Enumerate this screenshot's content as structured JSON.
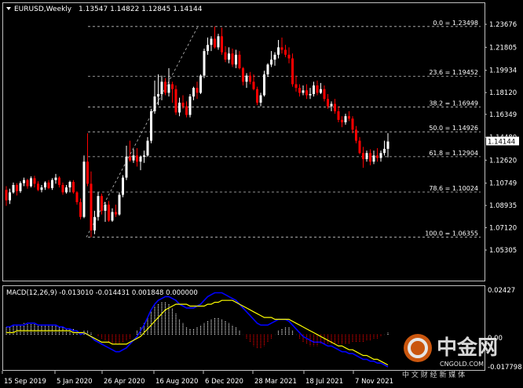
{
  "header": {
    "symbol": "EURUSD,Weekly",
    "ohlc": "1.13547 1.14822 1.12845 1.14144"
  },
  "colors": {
    "background": "#000000",
    "bull": "#ffffff",
    "bear": "#ff0000",
    "grid": "#c0c0c0",
    "macd_main": "#0000ff",
    "macd_signal": "#ffff00",
    "histogram_pos": "#ffffff",
    "histogram_neg": "#ff0000",
    "current_price_bg": "#ffffff"
  },
  "price_axis": {
    "ticks": [
      "1.23676",
      "1.21805",
      "1.19934",
      "1.18120",
      "1.16349",
      "1.14480",
      "1.12620",
      "1.10749",
      "1.08935",
      "1.07120",
      "1.05305"
    ],
    "current_price": "1.14144"
  },
  "fibonacci": [
    {
      "label": "0.0 = 1.23498",
      "value": 1.23498
    },
    {
      "label": "23.6 = 1.19452",
      "value": 1.19452
    },
    {
      "label": "38.2 = 1.16949",
      "value": 1.16949
    },
    {
      "label": "50.0 = 1.14926",
      "value": 1.14926
    },
    {
      "label": "61.8 = 1.12904",
      "value": 1.12904
    },
    {
      "label": "78.6 = 1.10024",
      "value": 1.10024
    },
    {
      "label": "100.0 = 1.06355",
      "value": 1.06355
    }
  ],
  "macd": {
    "label": "MACD(12,26,9) -0.013010 -0.014431 0.001848 0.000000",
    "ticks": [
      "0.02427",
      "0.00",
      "-0.017798"
    ]
  },
  "time_axis": {
    "labels": [
      "15 Sep 2019",
      "5 Jan 2020",
      "26 Apr 2020",
      "16 Aug 2020",
      "6 Dec 2020",
      "28 Mar 2021",
      "18 Jul 2021",
      "7 Nov 2021"
    ]
  },
  "watermark": {
    "brand": "中金网",
    "tagline": "中 文 财 经 新 媒 体",
    "url": "CNGOLD.COM"
  },
  "chart_data": {
    "type": "candlestick",
    "title": "EURUSD,Weekly",
    "ylim": [
      1.0455,
      1.2435
    ],
    "bars": [
      [
        1.102,
        1.105,
        1.089,
        1.0935
      ],
      [
        1.0935,
        1.103,
        1.0905,
        1.1
      ],
      [
        1.1,
        1.108,
        1.099,
        1.106
      ],
      [
        1.106,
        1.1075,
        1.0975,
        1.101
      ],
      [
        1.101,
        1.109,
        1.0995,
        1.1075
      ],
      [
        1.1075,
        1.112,
        1.105,
        1.11
      ],
      [
        1.11,
        1.111,
        1.103,
        1.105
      ],
      [
        1.105,
        1.113,
        1.104,
        1.1115
      ],
      [
        1.1115,
        1.1135,
        1.104,
        1.107
      ],
      [
        1.107,
        1.109,
        1.101,
        1.102
      ],
      [
        1.102,
        1.106,
        1.1,
        1.104
      ],
      [
        1.104,
        1.109,
        1.102,
        1.108
      ],
      [
        1.108,
        1.11,
        1.1025,
        1.1035
      ],
      [
        1.1035,
        1.1115,
        1.102,
        1.11
      ],
      [
        1.11,
        1.115,
        1.107,
        1.112
      ],
      [
        1.112,
        1.113,
        1.104,
        1.106
      ],
      [
        1.106,
        1.108,
        1.098,
        1.1
      ],
      [
        1.1,
        1.106,
        1.099,
        1.104
      ],
      [
        1.104,
        1.1095,
        1.1,
        1.1085
      ],
      [
        1.1085,
        1.11,
        1.099,
        1.1
      ],
      [
        1.1,
        1.101,
        1.09,
        1.092
      ],
      [
        1.092,
        1.095,
        1.078,
        1.08
      ],
      [
        1.08,
        1.13,
        1.079,
        1.125
      ],
      [
        1.125,
        1.148,
        1.105,
        1.107
      ],
      [
        1.107,
        1.117,
        1.0635,
        1.069
      ],
      [
        1.069,
        1.085,
        1.066,
        1.08
      ],
      [
        1.08,
        1.1,
        1.077,
        1.097
      ],
      [
        1.097,
        1.099,
        1.082,
        1.085
      ],
      [
        1.085,
        1.092,
        1.076,
        1.09
      ],
      [
        1.09,
        1.093,
        1.076,
        1.077
      ],
      [
        1.077,
        1.087,
        1.076,
        1.084
      ],
      [
        1.084,
        1.09,
        1.08,
        1.082
      ],
      [
        1.082,
        1.1,
        1.081,
        1.098
      ],
      [
        1.098,
        1.114,
        1.096,
        1.112
      ],
      [
        1.112,
        1.138,
        1.11,
        1.129
      ],
      [
        1.129,
        1.142,
        1.125,
        1.126
      ],
      [
        1.126,
        1.135,
        1.124,
        1.13
      ],
      [
        1.13,
        1.136,
        1.121,
        1.125
      ],
      [
        1.125,
        1.13,
        1.118,
        1.129
      ],
      [
        1.129,
        1.134,
        1.124,
        1.13
      ],
      [
        1.13,
        1.145,
        1.129,
        1.142
      ],
      [
        1.142,
        1.168,
        1.14,
        1.166
      ],
      [
        1.166,
        1.191,
        1.164,
        1.178
      ],
      [
        1.178,
        1.196,
        1.171,
        1.18
      ],
      [
        1.18,
        1.195,
        1.175,
        1.19
      ],
      [
        1.19,
        1.193,
        1.179,
        1.181
      ],
      [
        1.181,
        1.201,
        1.178,
        1.188
      ],
      [
        1.188,
        1.19,
        1.173,
        1.184
      ],
      [
        1.184,
        1.187,
        1.163,
        1.165
      ],
      [
        1.165,
        1.177,
        1.162,
        1.173
      ],
      [
        1.173,
        1.179,
        1.168,
        1.17
      ],
      [
        1.17,
        1.174,
        1.161,
        1.163
      ],
      [
        1.163,
        1.18,
        1.161,
        1.178
      ],
      [
        1.178,
        1.186,
        1.175,
        1.185
      ],
      [
        1.185,
        1.19,
        1.176,
        1.181
      ],
      [
        1.181,
        1.196,
        1.18,
        1.195
      ],
      [
        1.195,
        1.217,
        1.193,
        1.215
      ],
      [
        1.215,
        1.226,
        1.212,
        1.22
      ],
      [
        1.22,
        1.227,
        1.215,
        1.225
      ],
      [
        1.225,
        1.235,
        1.217,
        1.218
      ],
      [
        1.218,
        1.229,
        1.216,
        1.227
      ],
      [
        1.227,
        1.234,
        1.212,
        1.214
      ],
      [
        1.214,
        1.219,
        1.206,
        1.208
      ],
      [
        1.208,
        1.218,
        1.205,
        1.213
      ],
      [
        1.213,
        1.217,
        1.202,
        1.204
      ],
      [
        1.204,
        1.216,
        1.201,
        1.212
      ],
      [
        1.212,
        1.215,
        1.2,
        1.201
      ],
      [
        1.201,
        1.202,
        1.187,
        1.19
      ],
      [
        1.19,
        1.197,
        1.185,
        1.195
      ],
      [
        1.195,
        1.198,
        1.188,
        1.19
      ],
      [
        1.19,
        1.196,
        1.183,
        1.184
      ],
      [
        1.184,
        1.186,
        1.171,
        1.173
      ],
      [
        1.173,
        1.181,
        1.17,
        1.179
      ],
      [
        1.179,
        1.199,
        1.178,
        1.196
      ],
      [
        1.196,
        1.205,
        1.194,
        1.204
      ],
      [
        1.204,
        1.215,
        1.202,
        1.208
      ],
      [
        1.208,
        1.214,
        1.203,
        1.212
      ],
      [
        1.212,
        1.224,
        1.209,
        1.218
      ],
      [
        1.218,
        1.226,
        1.213,
        1.216
      ],
      [
        1.216,
        1.22,
        1.21,
        1.212
      ],
      [
        1.212,
        1.218,
        1.205,
        1.209
      ],
      [
        1.209,
        1.213,
        1.186,
        1.188
      ],
      [
        1.188,
        1.195,
        1.182,
        1.185
      ],
      [
        1.185,
        1.188,
        1.178,
        1.181
      ],
      [
        1.181,
        1.187,
        1.179,
        1.183
      ],
      [
        1.183,
        1.188,
        1.176,
        1.179
      ],
      [
        1.179,
        1.185,
        1.176,
        1.18
      ],
      [
        1.18,
        1.19,
        1.178,
        1.187
      ],
      [
        1.187,
        1.191,
        1.179,
        1.181
      ],
      [
        1.181,
        1.189,
        1.18,
        1.184
      ],
      [
        1.184,
        1.187,
        1.174,
        1.176
      ],
      [
        1.176,
        1.18,
        1.168,
        1.17
      ],
      [
        1.17,
        1.174,
        1.166,
        1.172
      ],
      [
        1.172,
        1.176,
        1.164,
        1.166
      ],
      [
        1.166,
        1.17,
        1.157,
        1.159
      ],
      [
        1.159,
        1.162,
        1.153,
        1.157
      ],
      [
        1.157,
        1.164,
        1.155,
        1.162
      ],
      [
        1.162,
        1.166,
        1.158,
        1.16
      ],
      [
        1.16,
        1.162,
        1.148,
        1.151
      ],
      [
        1.151,
        1.154,
        1.14,
        1.142
      ],
      [
        1.142,
        1.145,
        1.131,
        1.132
      ],
      [
        1.132,
        1.137,
        1.12,
        1.127
      ],
      [
        1.127,
        1.134,
        1.125,
        1.132
      ],
      [
        1.132,
        1.135,
        1.122,
        1.125
      ],
      [
        1.125,
        1.134,
        1.123,
        1.13
      ],
      [
        1.13,
        1.136,
        1.125,
        1.128
      ],
      [
        1.128,
        1.134,
        1.125,
        1.132
      ],
      [
        1.132,
        1.142,
        1.13,
        1.1354
      ],
      [
        1.1354,
        1.1482,
        1.1285,
        1.1414
      ]
    ],
    "macd_hist": [
      0.004,
      0.004,
      0.005,
      0.005,
      0.005,
      0.006,
      0.006,
      0.006,
      0.006,
      0.005,
      0.005,
      0.005,
      0.005,
      0.005,
      0.005,
      0.004,
      0.004,
      0.003,
      0.003,
      0.003,
      0.002,
      0.001,
      0.002,
      0.002,
      0.001,
      0.0,
      -0.001,
      -0.002,
      -0.003,
      -0.004,
      -0.005,
      -0.005,
      -0.005,
      -0.004,
      -0.003,
      -0.002,
      0.0,
      0.002,
      0.004,
      0.006,
      0.009,
      0.012,
      0.015,
      0.016,
      0.017,
      0.017,
      0.016,
      0.014,
      0.011,
      0.008,
      0.006,
      0.004,
      0.003,
      0.003,
      0.004,
      0.005,
      0.006,
      0.007,
      0.008,
      0.009,
      0.009,
      0.008,
      0.007,
      0.006,
      0.005,
      0.004,
      0.002,
      0.0,
      -0.002,
      -0.004,
      -0.006,
      -0.007,
      -0.007,
      -0.006,
      -0.004,
      -0.002,
      0.0,
      0.002,
      0.003,
      0.004,
      0.004,
      0.002,
      0.0,
      -0.002,
      -0.004,
      -0.005,
      -0.006,
      -0.006,
      -0.006,
      -0.005,
      -0.005,
      -0.005,
      -0.005,
      -0.005,
      -0.005,
      -0.005,
      -0.005,
      -0.005,
      -0.004,
      -0.004,
      -0.004,
      -0.004,
      -0.003,
      -0.003,
      -0.002,
      -0.002,
      -0.001,
      0.0,
      0.001
    ],
    "macd_main": [
      0.004,
      0.004,
      0.005,
      0.005,
      0.005,
      0.005,
      0.006,
      0.006,
      0.006,
      0.005,
      0.005,
      0.005,
      0.005,
      0.005,
      0.005,
      0.004,
      0.004,
      0.003,
      0.003,
      0.002,
      0.002,
      0.0,
      0.001,
      0.0,
      -0.001,
      -0.003,
      -0.004,
      -0.005,
      -0.006,
      -0.007,
      -0.008,
      -0.009,
      -0.009,
      -0.008,
      -0.007,
      -0.005,
      -0.003,
      -0.001,
      0.002,
      0.005,
      0.009,
      0.013,
      0.016,
      0.018,
      0.019,
      0.02,
      0.02,
      0.019,
      0.018,
      0.016,
      0.015,
      0.014,
      0.014,
      0.014,
      0.015,
      0.016,
      0.018,
      0.02,
      0.021,
      0.022,
      0.022,
      0.022,
      0.021,
      0.02,
      0.019,
      0.018,
      0.016,
      0.014,
      0.012,
      0.01,
      0.008,
      0.006,
      0.005,
      0.005,
      0.005,
      0.006,
      0.007,
      0.008,
      0.008,
      0.008,
      0.007,
      0.005,
      0.003,
      0.001,
      -0.001,
      -0.002,
      -0.003,
      -0.004,
      -0.004,
      -0.004,
      -0.005,
      -0.006,
      -0.006,
      -0.007,
      -0.008,
      -0.009,
      -0.009,
      -0.01,
      -0.01,
      -0.011,
      -0.012,
      -0.013,
      -0.013,
      -0.014,
      -0.014,
      -0.015,
      -0.015,
      -0.016,
      -0.017
    ],
    "macd_signal": [
      0.001,
      0.001,
      0.001,
      0.002,
      0.002,
      0.002,
      0.002,
      0.002,
      0.002,
      0.002,
      0.002,
      0.002,
      0.002,
      0.002,
      0.002,
      0.002,
      0.002,
      0.002,
      0.002,
      0.001,
      0.001,
      0.001,
      0.001,
      0.0,
      -0.001,
      -0.002,
      -0.003,
      -0.004,
      -0.004,
      -0.004,
      -0.005,
      -0.005,
      -0.005,
      -0.005,
      -0.005,
      -0.004,
      -0.003,
      -0.002,
      -0.001,
      0.001,
      0.003,
      0.005,
      0.007,
      0.009,
      0.011,
      0.013,
      0.014,
      0.015,
      0.016,
      0.016,
      0.016,
      0.016,
      0.015,
      0.015,
      0.015,
      0.015,
      0.015,
      0.016,
      0.016,
      0.017,
      0.017,
      0.018,
      0.018,
      0.018,
      0.018,
      0.017,
      0.016,
      0.015,
      0.014,
      0.013,
      0.012,
      0.011,
      0.01,
      0.009,
      0.009,
      0.009,
      0.008,
      0.008,
      0.008,
      0.008,
      0.008,
      0.007,
      0.006,
      0.005,
      0.004,
      0.003,
      0.002,
      0.001,
      0.0,
      -0.001,
      -0.002,
      -0.003,
      -0.004,
      -0.005,
      -0.006,
      -0.006,
      -0.007,
      -0.008,
      -0.008,
      -0.009,
      -0.01,
      -0.011,
      -0.011,
      -0.012,
      -0.013,
      -0.013,
      -0.014,
      -0.015,
      -0.016
    ]
  }
}
